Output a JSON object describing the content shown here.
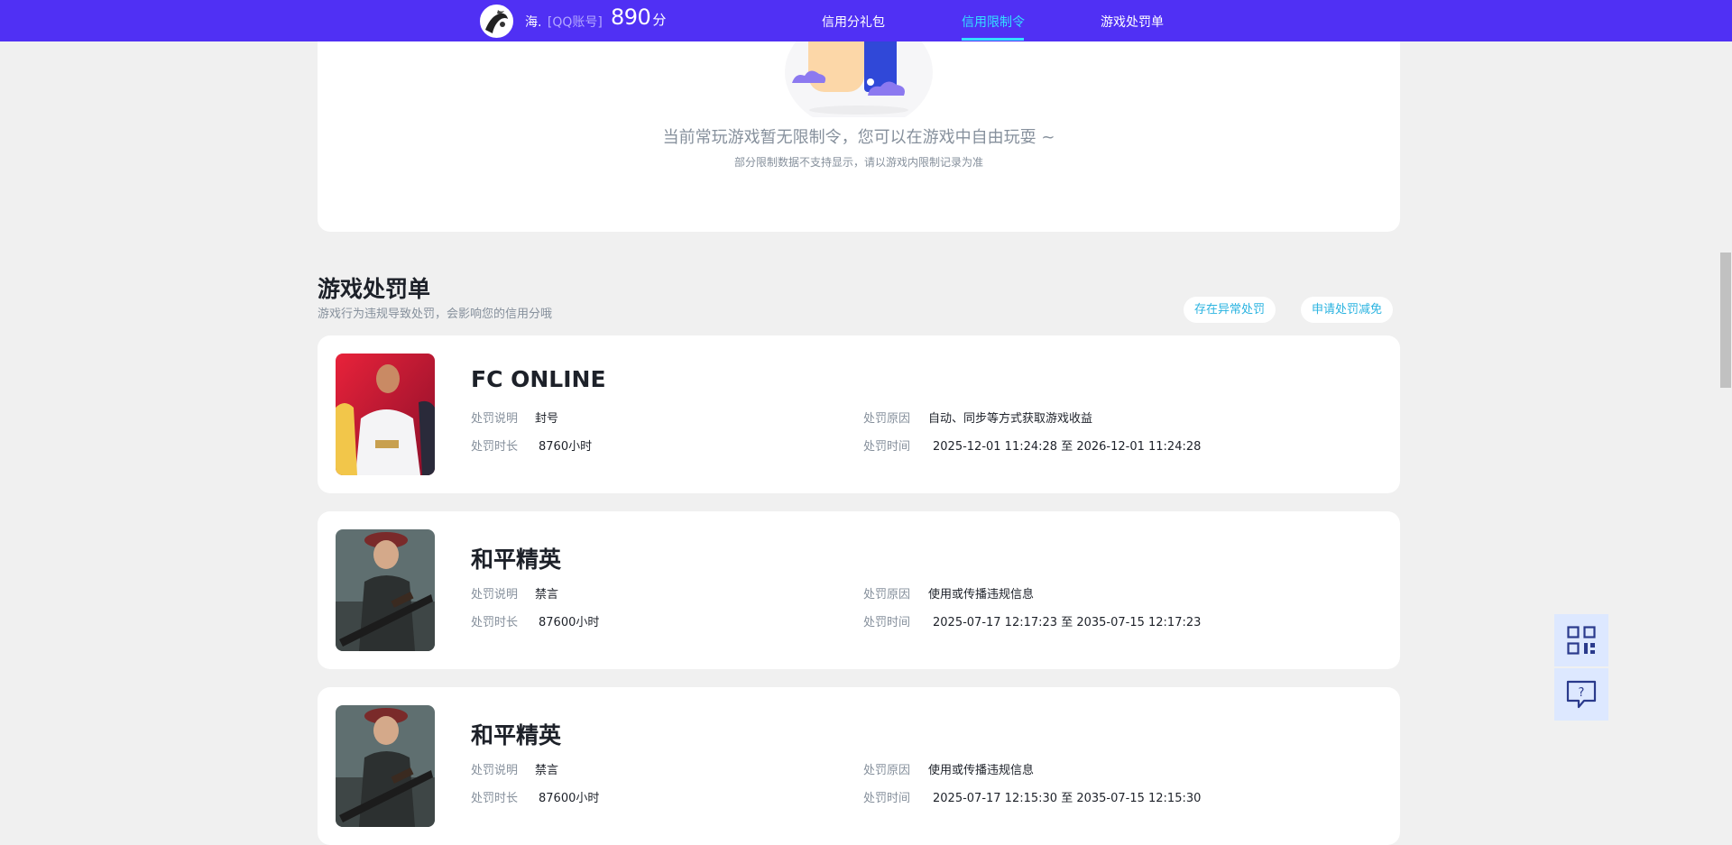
{
  "header": {
    "nickname": "海.",
    "account_type": "[QQ账号]",
    "score": "890",
    "score_unit": "分",
    "tabs": [
      {
        "label": "信用分礼包",
        "active": false
      },
      {
        "label": "信用限制令",
        "active": true
      },
      {
        "label": "游戏处罚单",
        "active": false
      }
    ]
  },
  "restriction": {
    "empty_message": "当前常玩游戏暂无限制令，您可以在游戏中自由玩耍 ~",
    "empty_note": "部分限制数据不支持显示，请以游戏内限制记录为准"
  },
  "penalty_section": {
    "title": "游戏处罚单",
    "subtitle": "游戏行为违规导致处罚，会影响您的信用分哦",
    "buttons": {
      "abnormal": "存在异常处罚",
      "appeal": "申请处罚减免"
    },
    "labels": {
      "desc": "处罚说明",
      "duration": "处罚时长",
      "reason": "处罚原因",
      "time": "处罚时间"
    },
    "items": [
      {
        "game": "FC ONLINE",
        "desc": "封号",
        "duration": "8760小时",
        "reason": "自动、同步等方式获取游戏收益",
        "time": "2025-12-01 11:24:28 至 2026-12-01 11:24:28"
      },
      {
        "game": "和平精英",
        "desc": "禁言",
        "duration": "87600小时",
        "reason": "使用或传播违规信息",
        "time": "2025-07-17 12:17:23 至 2035-07-15 12:17:23"
      },
      {
        "game": "和平精英",
        "desc": "禁言",
        "duration": "87600小时",
        "reason": "使用或传播违规信息",
        "time": "2025-07-17 12:15:30 至 2035-07-15 12:15:30"
      }
    ]
  },
  "colors": {
    "nav_bg": "#5030f4",
    "nav_active": "#33e0ff",
    "link": "#2ab3e0",
    "page_bg": "#f0f0f0"
  }
}
